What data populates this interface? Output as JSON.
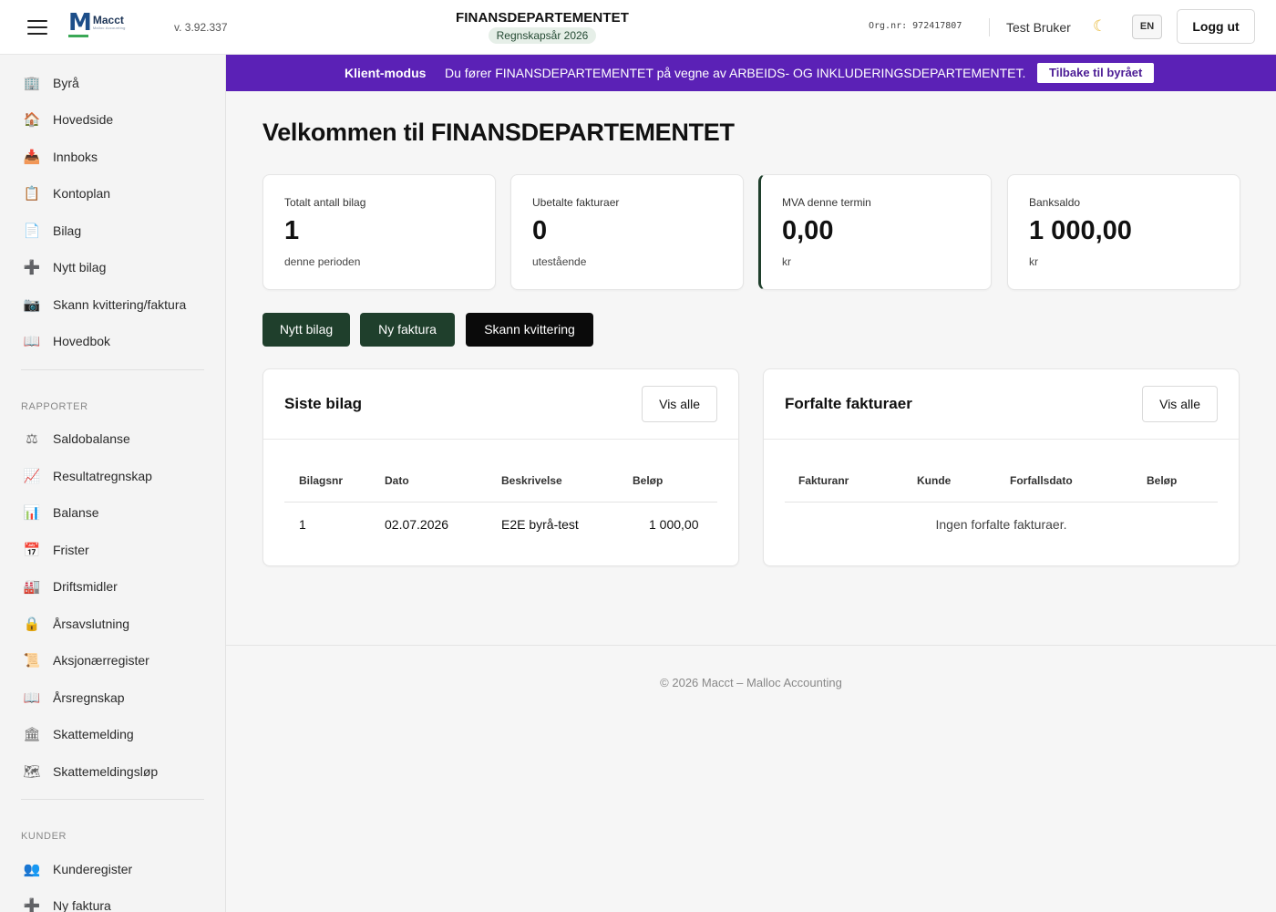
{
  "header": {
    "logo_name": "Macct",
    "logo_sub": "Malloc Accounting",
    "version": "v. 3.92.337",
    "org_title": "FINANSDEPARTEMENTET",
    "year_badge": "Regnskapsår 2026",
    "orgnr": "Org.nr: 972417807",
    "username": "Test Bruker",
    "theme_icon": "moon-icon",
    "lang": "EN",
    "logout": "Logg ut"
  },
  "sidebar": {
    "items": [
      {
        "label": "Byrå",
        "icon": "🏢",
        "icon_name": "building-icon"
      },
      {
        "label": "Hovedside",
        "icon": "🏠",
        "icon_name": "house-icon"
      },
      {
        "label": "Innboks",
        "icon": "📥",
        "icon_name": "inbox-icon"
      },
      {
        "label": "Kontoplan",
        "icon": "📋",
        "icon_name": "clipboard-icon"
      },
      {
        "label": "Bilag",
        "icon": "📄",
        "icon_name": "document-icon"
      },
      {
        "label": "Nytt bilag",
        "icon": "➕",
        "icon_name": "plus-icon"
      },
      {
        "label": "Skann kvittering/faktura",
        "icon": "📷",
        "icon_name": "camera-icon"
      },
      {
        "label": "Hovedbok",
        "icon": "📖",
        "icon_name": "book-icon"
      }
    ],
    "section_reports": "RAPPORTER",
    "reports": [
      {
        "label": "Saldobalanse",
        "icon": "⚖",
        "icon_name": "scales-icon"
      },
      {
        "label": "Resultatregnskap",
        "icon": "📈",
        "icon_name": "chart-up-icon"
      },
      {
        "label": "Balanse",
        "icon": "📊",
        "icon_name": "bar-chart-icon"
      },
      {
        "label": "Frister",
        "icon": "📅",
        "icon_name": "calendar-icon"
      },
      {
        "label": "Driftsmidler",
        "icon": "🏭",
        "icon_name": "factory-icon"
      },
      {
        "label": "Årsavslutning",
        "icon": "🔒",
        "icon_name": "lock-icon"
      },
      {
        "label": "Aksjonærregister",
        "icon": "📜",
        "icon_name": "scroll-icon"
      },
      {
        "label": "Årsregnskap",
        "icon": "📖",
        "icon_name": "book-icon"
      },
      {
        "label": "Skattemelding",
        "icon": "🏛",
        "icon_name": "government-icon"
      },
      {
        "label": "Skattemeldingsløp",
        "icon": "🗺",
        "icon_name": "map-icon"
      }
    ],
    "section_customers": "KUNDER",
    "customers": [
      {
        "label": "Kunderegister",
        "icon": "👥",
        "icon_name": "users-icon"
      },
      {
        "label": "Ny faktura",
        "icon": "➕",
        "icon_name": "plus-icon"
      }
    ]
  },
  "banner": {
    "mode": "Klient-modus",
    "message": "Du fører FINANSDEPARTEMENTET på vegne av ARBEIDS- OG INKLUDERINGSDEPARTEMENTET.",
    "back": "Tilbake til byrået"
  },
  "main": {
    "welcome": "Velkommen til FINANSDEPARTEMENTET",
    "stats": [
      {
        "label": "Totalt antall bilag",
        "value": "1",
        "sub": "denne perioden"
      },
      {
        "label": "Ubetalte fakturaer",
        "value": "0",
        "sub": "utestående"
      },
      {
        "label": "MVA denne termin",
        "value": "0,00",
        "sub": "kr"
      },
      {
        "label": "Banksaldo",
        "value": "1 000,00",
        "sub": "kr"
      }
    ],
    "actions": {
      "new_voucher": "Nytt bilag",
      "new_invoice": "Ny faktura",
      "scan_receipt": "Skann kvittering"
    },
    "recent": {
      "title": "Siste bilag",
      "show_all": "Vis alle",
      "columns": [
        "Bilagsnr",
        "Dato",
        "Beskrivelse",
        "Beløp"
      ],
      "rows": [
        [
          "1",
          "02.07.2026",
          "E2E byrå-test",
          "1 000,00"
        ]
      ]
    },
    "overdue": {
      "title": "Forfalte fakturaer",
      "show_all": "Vis alle",
      "columns": [
        "Fakturanr",
        "Kunde",
        "Forfallsdato",
        "Beløp"
      ],
      "empty": "Ingen forfalte fakturaer."
    }
  },
  "footer": "© 2026 Macct – Malloc Accounting",
  "colors": {
    "brand_green": "#1f3f2c",
    "banner_purple": "#5b21b6",
    "logo_blue": "#1d4e89"
  }
}
